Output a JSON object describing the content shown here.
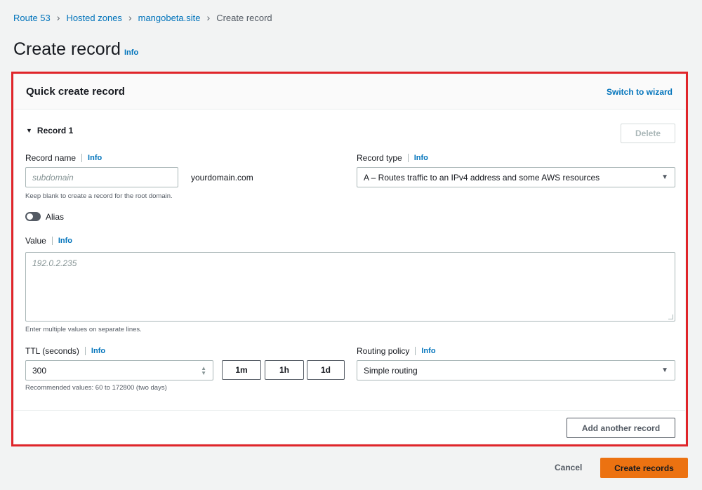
{
  "breadcrumbs": {
    "items": [
      "Route 53",
      "Hosted zones",
      "mangobeta.site"
    ],
    "current": "Create record"
  },
  "page": {
    "title": "Create record",
    "info_label": "Info"
  },
  "panel": {
    "title": "Quick create record",
    "switch_label": "Switch to wizard"
  },
  "record": {
    "header": "Record 1",
    "delete_label": "Delete",
    "name_label": "Record name",
    "info_label": "Info",
    "name_placeholder": "subdomain",
    "name_suffix": "yourdomain.com",
    "name_hint": "Keep blank to create a record for the root domain.",
    "type_label": "Record type",
    "type_value": "A – Routes traffic to an IPv4 address and some AWS resources",
    "alias_label": "Alias",
    "alias_enabled": false,
    "value_label": "Value",
    "value_placeholder": "192.0.2.235",
    "value_hint": "Enter multiple values on separate lines.",
    "ttl_label": "TTL (seconds)",
    "ttl_value": "300",
    "ttl_presets": [
      "1m",
      "1h",
      "1d"
    ],
    "ttl_hint": "Recommended values: 60 to 172800 (two days)",
    "routing_label": "Routing policy",
    "routing_value": "Simple routing"
  },
  "actions": {
    "add_record": "Add another record",
    "cancel": "Cancel",
    "create": "Create records"
  },
  "colors": {
    "link": "#0073bb",
    "primary": "#ec7211",
    "highlight_border": "#e0252a"
  }
}
